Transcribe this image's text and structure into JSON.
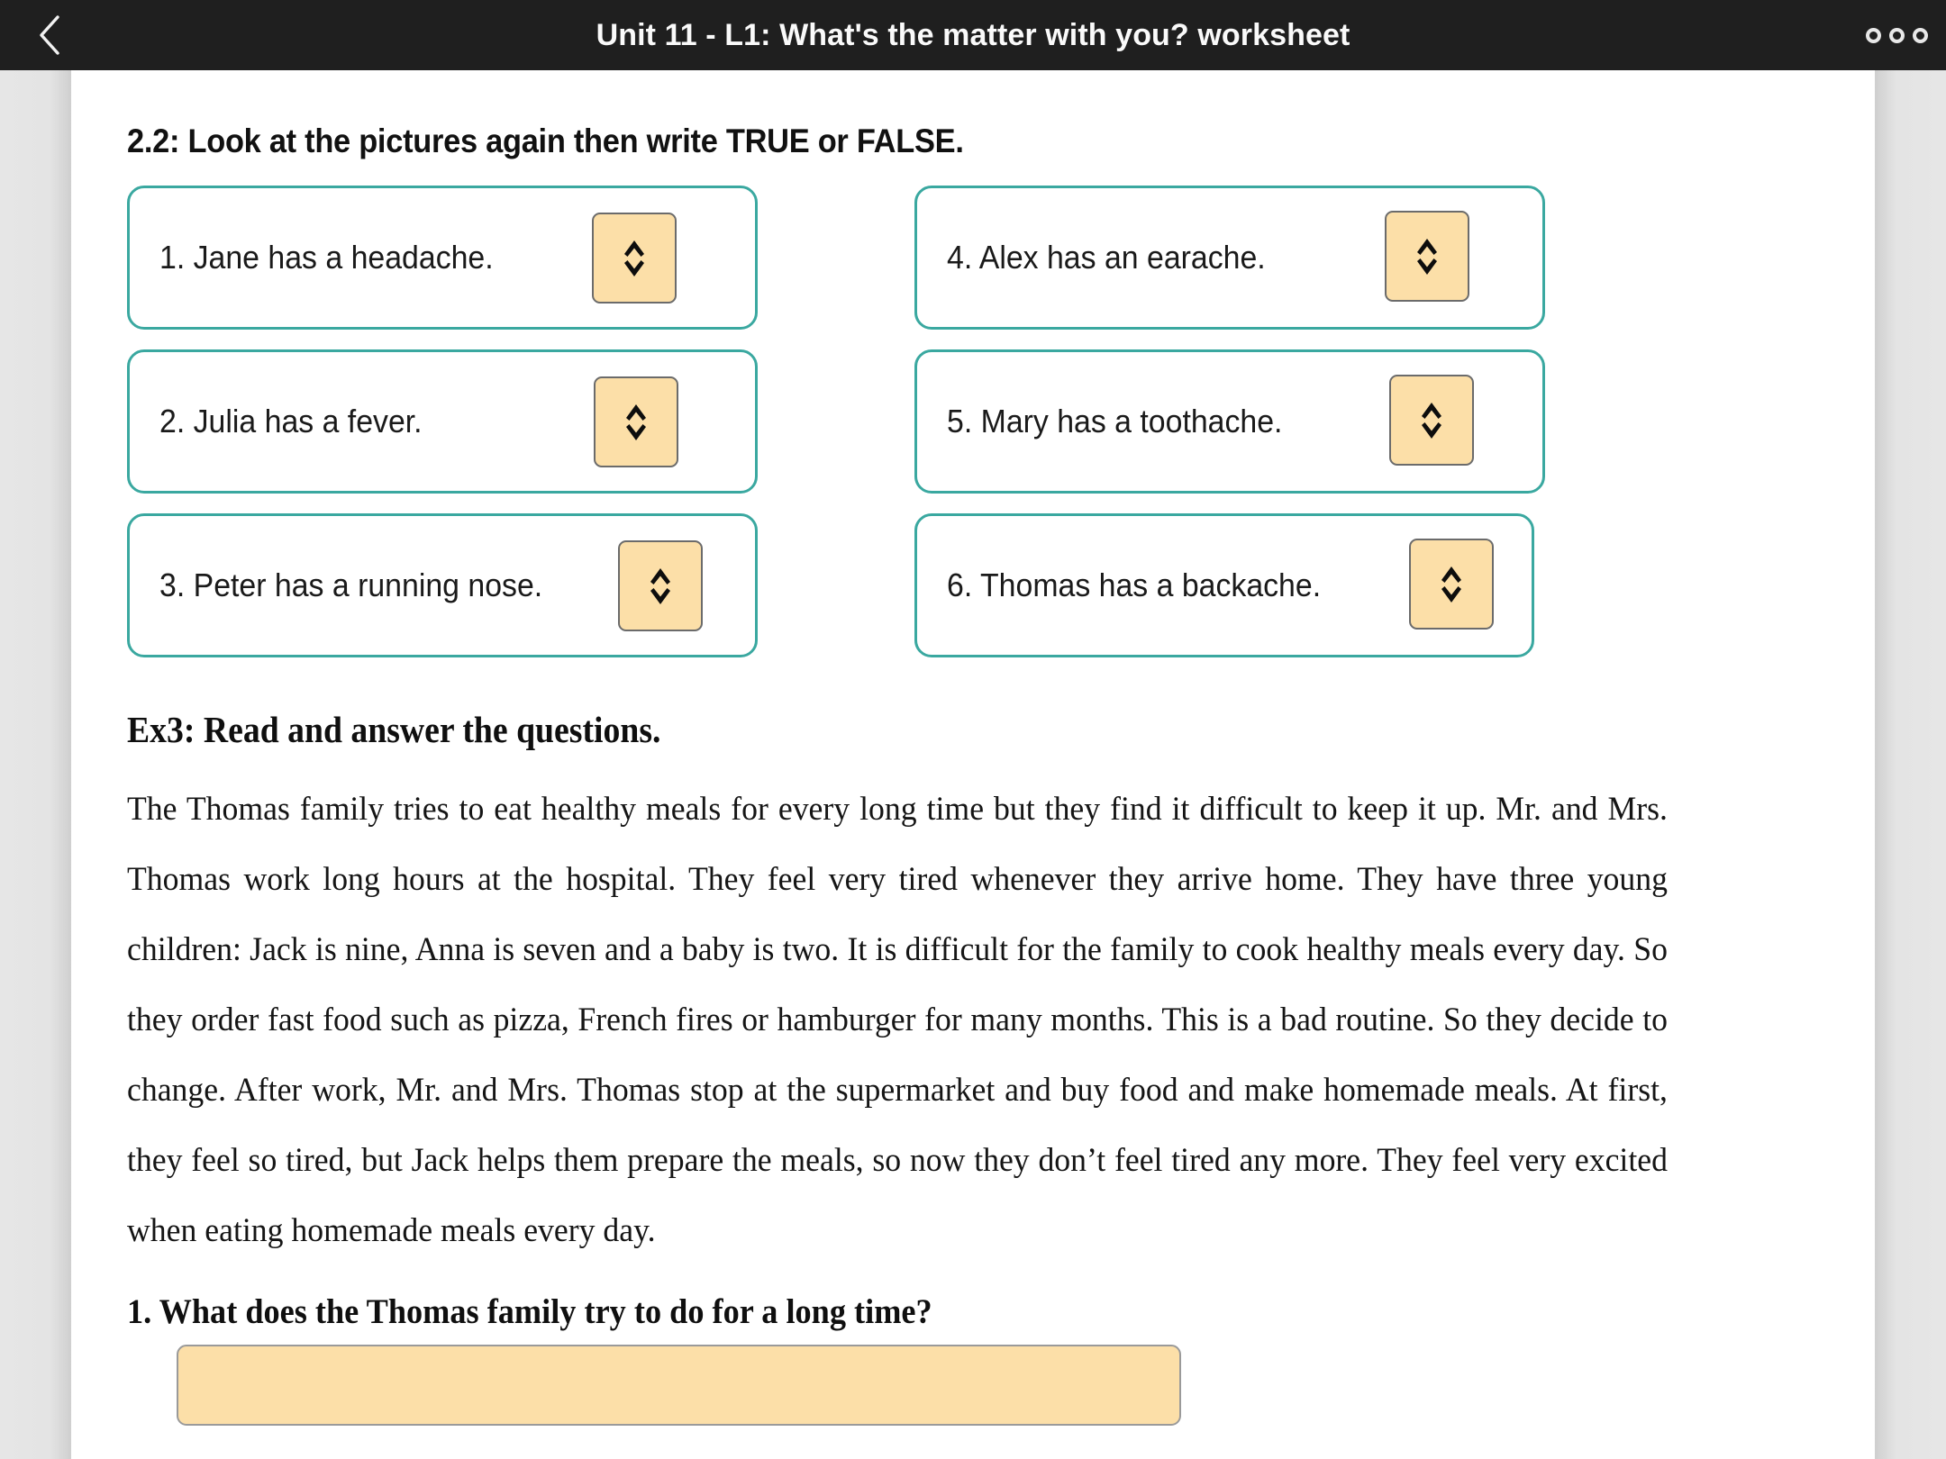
{
  "appbar": {
    "back_icon": "chevron-left-icon",
    "title": "Unit 11 - L1: What's the matter with you? worksheet",
    "menu_icon": "more-horizontal-icon"
  },
  "colors": {
    "appbar_bg": "#1f1f1f",
    "page_bg": "#ffffff",
    "gutter_bg": "#e3e3e3",
    "box_border_teal": "#3aa8a0",
    "select_fill_peach": "#fcdfa8",
    "select_border": "#6b6b6b",
    "text": "#151515"
  },
  "exercise_22": {
    "heading": "2.2: Look at the pictures again then write TRUE or FALSE.",
    "select_icon": "chevron-up-down-icon",
    "select_value": "",
    "select_placeholder": "",
    "items": [
      {
        "label": "1. Jane has a headache."
      },
      {
        "label": "2. Julia has a fever."
      },
      {
        "label": "3. Peter has a running nose."
      },
      {
        "label": "4. Alex has an earache."
      },
      {
        "label": "5. Mary has a toothache."
      },
      {
        "label": "6. Thomas has a backache."
      }
    ]
  },
  "exercise_3": {
    "heading": "Ex3: Read and answer the questions.",
    "passage": "The Thomas family tries to eat healthy meals for every long time but they find it difficult to keep it up. Mr. and Mrs. Thomas work long hours at the hospital. They feel very tired whenever they arrive home. They have three young children: Jack is nine, Anna is seven and a baby is two. It is difficult for the family to cook healthy meals every day. So they order fast food such as pizza, French fires or hamburger for many months. This is a bad routine. So they decide to change. After work, Mr. and Mrs. Thomas stop at the supermarket and buy food and make homemade meals. At first, they feel so tired, but Jack helps them prepare the meals, so now they don’t feel tired any more. They feel very excited when eating homemade meals every day.",
    "questions": [
      {
        "label": "1. What does the Thomas family try to do for a long time?",
        "answer_value": "",
        "answer_placeholder": ""
      }
    ]
  }
}
